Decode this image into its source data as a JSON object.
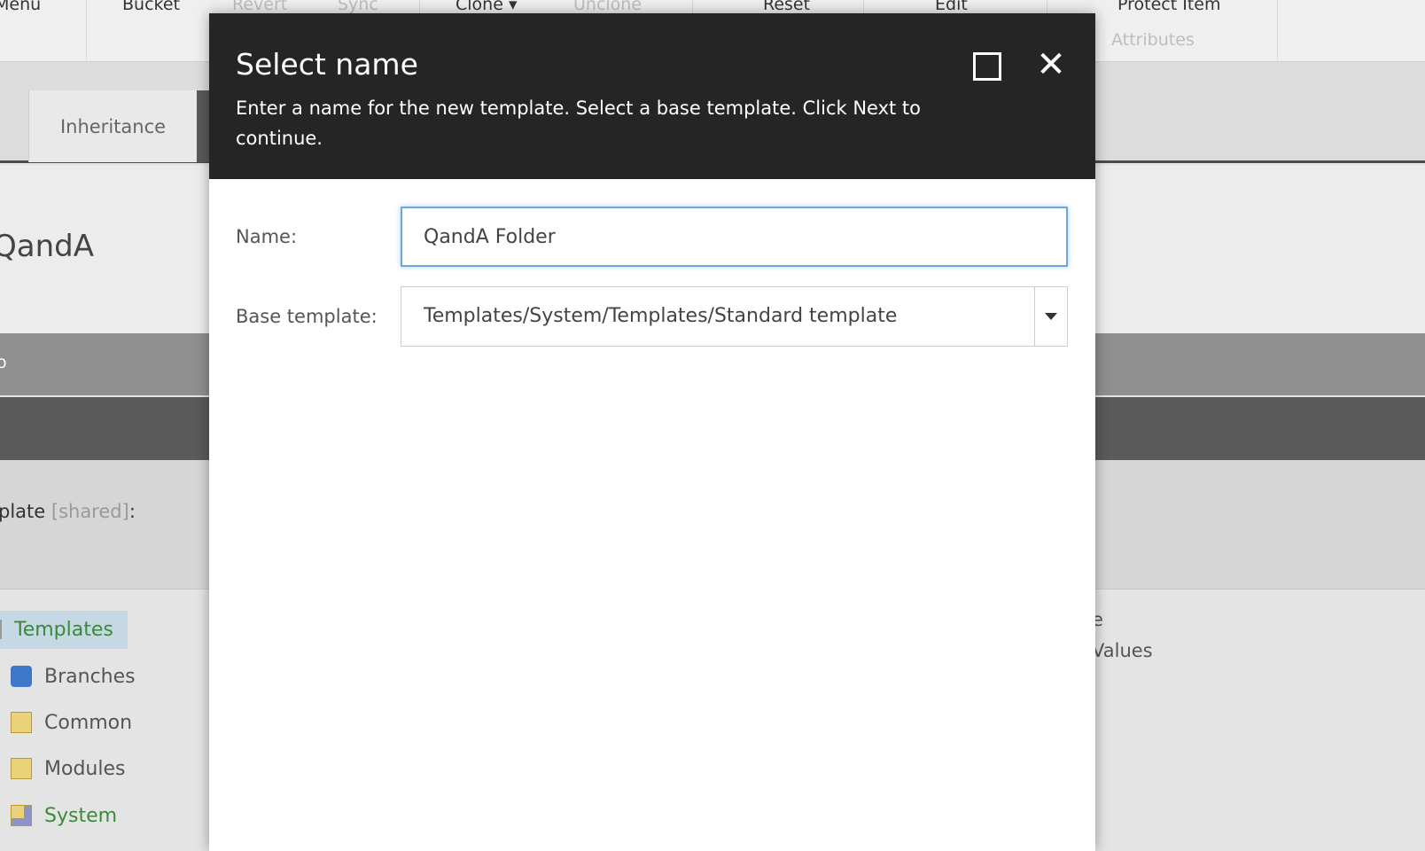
{
  "toolbar": {
    "items": [
      {
        "label": "Menu",
        "disabled": false
      },
      {
        "label": "Bucket",
        "disabled": false
      },
      {
        "label": "Revert",
        "disabled": true
      },
      {
        "label": "Sync",
        "disabled": true
      },
      {
        "label": "Clone ▾",
        "disabled": false
      },
      {
        "label": "Unclone",
        "disabled": true
      },
      {
        "label": "Reset",
        "disabled": false
      },
      {
        "label": "Edit",
        "disabled": false
      },
      {
        "label": "Protect Item",
        "disabled": false
      }
    ],
    "group_label": "Attributes"
  },
  "tabs": {
    "inheritance": "Inheritance"
  },
  "item": {
    "title": "QandA",
    "section": "o",
    "field_label": "plate",
    "field_shared": "[shared]",
    "field_colon": ":"
  },
  "tree": [
    {
      "label": "Templates",
      "icon": "template-icon",
      "color": "green"
    },
    {
      "label": "Branches",
      "icon": "puzzle-icon",
      "color": "grey"
    },
    {
      "label": "Common",
      "icon": "folder-icon",
      "color": "grey"
    },
    {
      "label": "Modules",
      "icon": "folder-icon",
      "color": "grey"
    },
    {
      "label": "System",
      "icon": "system-folder-icon",
      "color": "green"
    }
  ],
  "right_list": [
    "e",
    "Values"
  ],
  "dialog": {
    "title": "Select name",
    "description": "Enter a name for the new template. Select a base template. Click Next to continue.",
    "name_label": "Name:",
    "name_value": "QandA Folder",
    "base_label": "Base template:",
    "base_value": "Templates/System/Templates/Standard template"
  }
}
